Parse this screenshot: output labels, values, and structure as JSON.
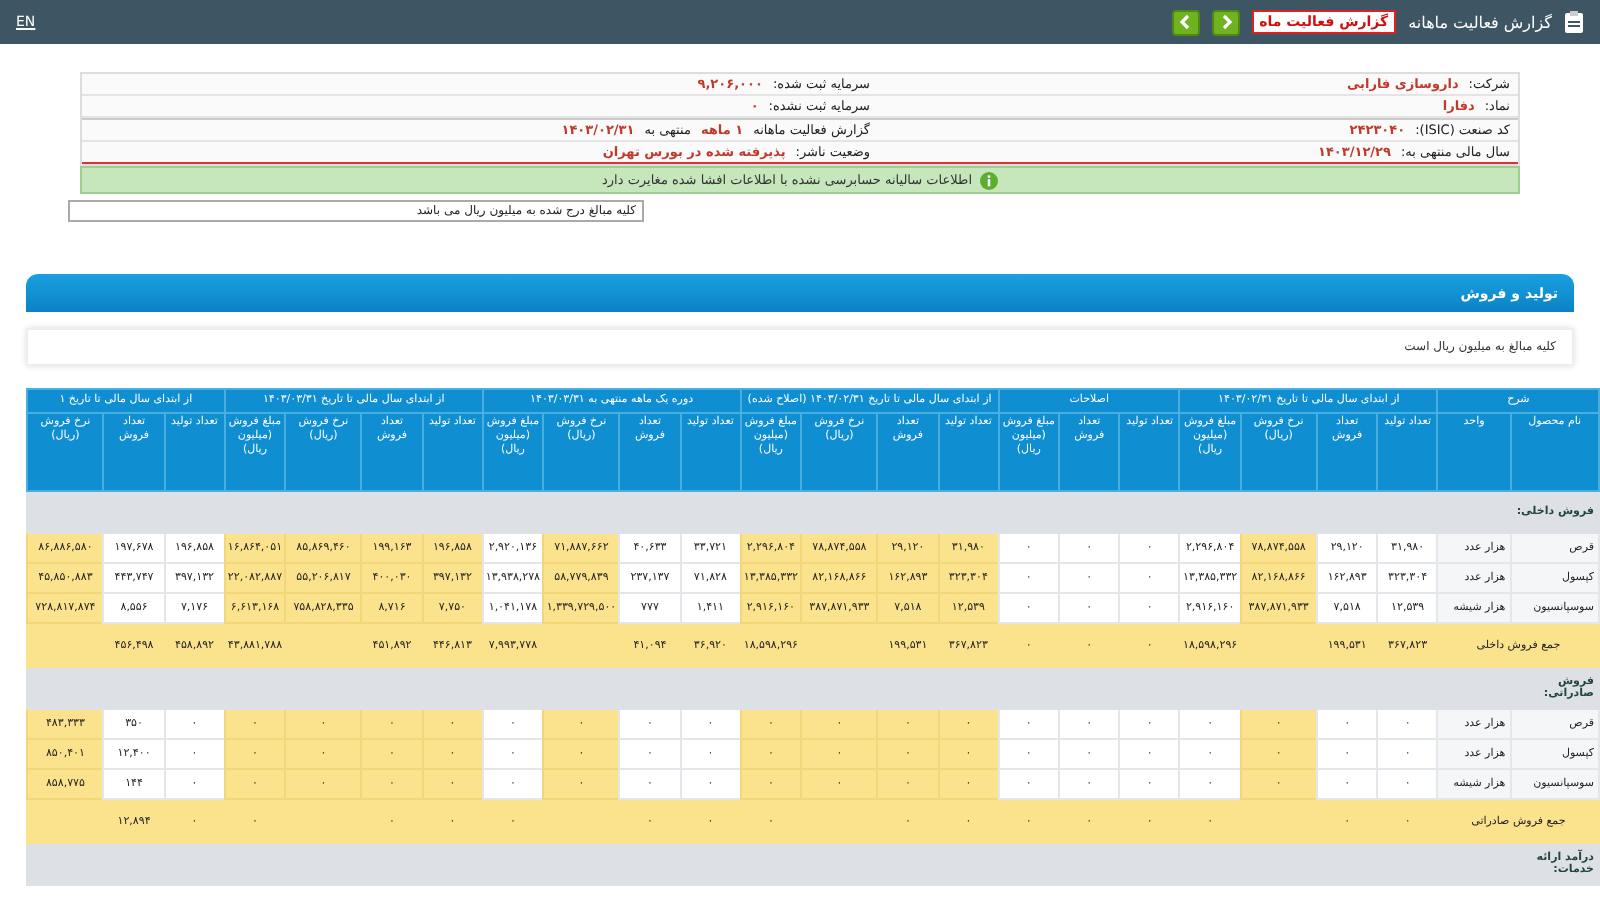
{
  "top_bar": {
    "title": "گزارش فعالیت ماهانه",
    "report_link": "گزارش فعالیت ماه",
    "language_link": "EN"
  },
  "info": {
    "rows": [
      {
        "right": [
          {
            "text": "شرکت:",
            "emphasized": false
          },
          {
            "text": "داروسازی فارابی",
            "emphasized": true
          }
        ],
        "left": [
          {
            "text": "سرمایه ثبت شده:",
            "emphasized": false
          },
          {
            "text": "۹,۲۰۶,۰۰۰",
            "emphasized": true
          }
        ]
      },
      {
        "right": [
          {
            "text": "نماد:",
            "emphasized": false
          },
          {
            "text": "دفارا",
            "emphasized": true
          }
        ],
        "left": [
          {
            "text": "سرمایه ثبت نشده:",
            "emphasized": false
          },
          {
            "text": "۰",
            "emphasized": true
          }
        ]
      },
      {
        "right": [
          {
            "text": "کد صنعت (ISIC):",
            "emphasized": false
          },
          {
            "text": "۲۴۲۳۰۴۰",
            "emphasized": true
          }
        ],
        "left": [
          {
            "text": "گزارش فعالیت ماهانه",
            "emphasized": false
          },
          {
            "text": "۱ ماهه",
            "emphasized": true
          },
          {
            "text": "منتهی به",
            "emphasized": false
          },
          {
            "text": "۱۴۰۳/۰۲/۳۱",
            "emphasized": true
          }
        ]
      },
      {
        "right": [
          {
            "text": "سال مالی منتهی به:",
            "emphasized": false
          },
          {
            "text": "۱۴۰۳/۱۲/۲۹",
            "emphasized": true
          }
        ],
        "left": [
          {
            "text": "وضعیت ناشر:",
            "emphasized": false
          },
          {
            "text": "پذیرفته شده در بورس تهران",
            "emphasized": true
          }
        ]
      }
    ]
  },
  "notice": "اطلاعات سالیانه حسابرسی نشده با اطلاعات افشا شده مغایرت دارد",
  "amount_select": "کلیه مبالغ درج شده به میلیون ریال می باشد",
  "section": {
    "title": "تولید و فروش",
    "note": "کلیه مبالغ به میلیون ریال است"
  },
  "table": {
    "groups": [
      {
        "label": "شرح",
        "columns": [
          {
            "label": "نام محصول",
            "kind": "name"
          },
          {
            "label": "واحد",
            "kind": "unit"
          }
        ]
      },
      {
        "label": "از ابتدای سال مالی تا تاریخ ۱۴۰۳/۰۲/۳۱",
        "columns": [
          {
            "label": "تعداد تولید",
            "kind": "count",
            "highlighted": false
          },
          {
            "label": "تعداد فروش",
            "kind": "count",
            "highlighted": false
          },
          {
            "label": "نرخ فروش (ریال)",
            "kind": "rate",
            "highlighted": true
          },
          {
            "label": "مبلغ فروش (میلیون ریال)",
            "kind": "amount",
            "highlighted": false
          }
        ]
      },
      {
        "label": "اصلاحات",
        "columns": [
          {
            "label": "تعداد تولید",
            "kind": "count",
            "highlighted": false
          },
          {
            "label": "تعداد فروش",
            "kind": "count",
            "highlighted": false
          },
          {
            "label": "مبلغ فروش (میلیون ریال)",
            "kind": "amount",
            "highlighted": false
          }
        ]
      },
      {
        "label": "از ابتدای سال مالی تا تاریخ ۱۴۰۳/۰۲/۳۱ (اصلاح شده)",
        "columns": [
          {
            "label": "تعداد تولید",
            "kind": "count",
            "highlighted": true
          },
          {
            "label": "تعداد فروش",
            "kind": "count",
            "highlighted": true
          },
          {
            "label": "نرخ فروش (ریال)",
            "kind": "rate",
            "highlighted": true
          },
          {
            "label": "مبلغ فروش (میلیون ریال)",
            "kind": "amount",
            "highlighted": true
          }
        ]
      },
      {
        "label": "دوره یک ماهه منتهی به ۱۴۰۳/۰۳/۳۱",
        "columns": [
          {
            "label": "تعداد تولید",
            "kind": "count",
            "highlighted": false
          },
          {
            "label": "تعداد فروش",
            "kind": "count",
            "highlighted": false
          },
          {
            "label": "نرخ فروش (ریال)",
            "kind": "rate",
            "highlighted": true
          },
          {
            "label": "مبلغ فروش (میلیون ریال)",
            "kind": "amount",
            "highlighted": false
          }
        ]
      },
      {
        "label": "از ابتدای سال مالی تا تاریخ ۱۴۰۳/۰۳/۳۱",
        "columns": [
          {
            "label": "تعداد تولید",
            "kind": "count",
            "highlighted": true
          },
          {
            "label": "تعداد فروش",
            "kind": "count",
            "highlighted": true
          },
          {
            "label": "نرخ فروش (ریال)",
            "kind": "rate",
            "highlighted": true
          },
          {
            "label": "مبلغ فروش (میلیون ریال)",
            "kind": "amount",
            "highlighted": true
          }
        ]
      },
      {
        "label": "از ابتدای سال مالی تا تاریخ ۱",
        "columns": [
          {
            "label": "تعداد تولید",
            "kind": "count",
            "highlighted": false
          },
          {
            "label": "تعداد فروش",
            "kind": "count",
            "highlighted": false
          },
          {
            "label": "نرخ فروش (ریال)",
            "kind": "rate",
            "highlighted": true
          }
        ]
      }
    ],
    "sections": [
      {
        "title": "فروش داخلی:",
        "rows": [
          {
            "product": "قرص",
            "unit": "هزار عدد",
            "values": [
              "۳۱,۹۸۰",
              "۲۹,۱۲۰",
              "۷۸,۸۷۴,۵۵۸",
              "۲,۲۹۶,۸۰۴",
              "۰",
              "۰",
              "۰",
              "۳۱,۹۸۰",
              "۲۹,۱۲۰",
              "۷۸,۸۷۴,۵۵۸",
              "۲,۲۹۶,۸۰۴",
              "۳۳,۷۲۱",
              "۴۰,۶۳۳",
              "۷۱,۸۸۷,۶۶۲",
              "۲,۹۲۰,۱۳۶",
              "۱۹۶,۸۵۸",
              "۱۹۹,۱۶۳",
              "۸۵,۸۶۹,۴۶۰",
              "۱۶,۸۶۴,۰۵۱",
              "۱۹۶,۸۵۸",
              "۱۹۷,۶۷۸",
              "۸۶,۸۸۶,۵۸۰"
            ]
          },
          {
            "product": "کپسول",
            "unit": "هزار عدد",
            "values": [
              "۳۲۳,۳۰۴",
              "۱۶۲,۸۹۳",
              "۸۲,۱۶۸,۸۶۶",
              "۱۳,۳۸۵,۳۳۲",
              "۰",
              "۰",
              "۰",
              "۳۲۳,۳۰۴",
              "۱۶۲,۸۹۳",
              "۸۲,۱۶۸,۸۶۶",
              "۱۳,۳۸۵,۳۳۲",
              "۷۱,۸۲۸",
              "۲۳۷,۱۳۷",
              "۵۸,۷۷۹,۸۳۹",
              "۱۳,۹۳۸,۲۷۸",
              "۳۹۷,۱۳۲",
              "۴۰۰,۰۳۰",
              "۵۵,۲۰۶,۸۱۷",
              "۲۲,۰۸۲,۸۸۷",
              "۳۹۷,۱۳۲",
              "۴۴۳,۷۴۷",
              "۴۵,۸۵۰,۸۸۳"
            ]
          },
          {
            "product": "سوسپانسیون",
            "unit": "هزار شیشه",
            "values": [
              "۱۲,۵۳۹",
              "۷,۵۱۸",
              "۳۸۷,۸۷۱,۹۳۳",
              "۲,۹۱۶,۱۶۰",
              "۰",
              "۰",
              "۰",
              "۱۲,۵۳۹",
              "۷,۵۱۸",
              "۳۸۷,۸۷۱,۹۳۳",
              "۲,۹۱۶,۱۶۰",
              "۱,۴۱۱",
              "۷۷۷",
              "۱,۳۳۹,۷۲۹,۵۰۰",
              "۱,۰۴۱,۱۷۸",
              "۷,۷۵۰",
              "۸,۷۱۶",
              "۷۵۸,۸۲۸,۳۳۵",
              "۶,۶۱۳,۱۶۸",
              "۷,۱۷۶",
              "۸,۵۵۶",
              "۷۲۸,۸۱۷,۸۷۴"
            ]
          }
        ],
        "total": {
          "label": "جمع فروش داخلی",
          "values": [
            "۳۶۷,۸۲۳",
            "۱۹۹,۵۳۱",
            "۱۸,۵۹۸,۲۹۶",
            "۰",
            "۰",
            "۰",
            "۳۶۷,۸۲۳",
            "۱۹۹,۵۳۱",
            "۱۸,۵۹۸,۲۹۶",
            "۳۶,۹۲۰",
            "۴۱,۰۹۴",
            "۷,۹۹۳,۷۷۸",
            "۴۴۶,۸۱۳",
            "۴۵۱,۸۹۲",
            "۴۳,۸۸۱,۷۸۸",
            "۴۵۸,۸۹۲",
            "۴۵۶,۴۹۸"
          ]
        }
      },
      {
        "title": "فروش صادراتی:",
        "rows": [
          {
            "product": "قرص",
            "unit": "هزار عدد",
            "values": [
              "۰",
              "۰",
              "۰",
              "۰",
              "۰",
              "۰",
              "۰",
              "۰",
              "۰",
              "۰",
              "۰",
              "۰",
              "۰",
              "۰",
              "۰",
              "۰",
              "۰",
              "۰",
              "۰",
              "۰",
              "۳۵۰",
              "۴۸۳,۳۳۳"
            ]
          },
          {
            "product": "کپسول",
            "unit": "هزار عدد",
            "values": [
              "۰",
              "۰",
              "۰",
              "۰",
              "۰",
              "۰",
              "۰",
              "۰",
              "۰",
              "۰",
              "۰",
              "۰",
              "۰",
              "۰",
              "۰",
              "۰",
              "۰",
              "۰",
              "۰",
              "۰",
              "۱۲,۴۰۰",
              "۸۵۰,۴۰۱"
            ]
          },
          {
            "product": "سوسپانسیون",
            "unit": "هزار شیشه",
            "values": [
              "۰",
              "۰",
              "۰",
              "۰",
              "۰",
              "۰",
              "۰",
              "۰",
              "۰",
              "۰",
              "۰",
              "۰",
              "۰",
              "۰",
              "۰",
              "۰",
              "۰",
              "۰",
              "۰",
              "۰",
              "۱۴۴",
              "۸۵۸,۷۷۵"
            ]
          }
        ],
        "total": {
          "label": "جمع فروش صادراتی",
          "values": [
            "۰",
            "۰",
            "۰",
            "۰",
            "۰",
            "۰",
            "۰",
            "۰",
            "۰",
            "۰",
            "۰",
            "۰",
            "۰",
            "۰",
            "۰",
            "۰",
            "۱۲,۸۹۴"
          ]
        }
      },
      {
        "title": "درآمد ارائه خدمات:"
      }
    ]
  }
}
